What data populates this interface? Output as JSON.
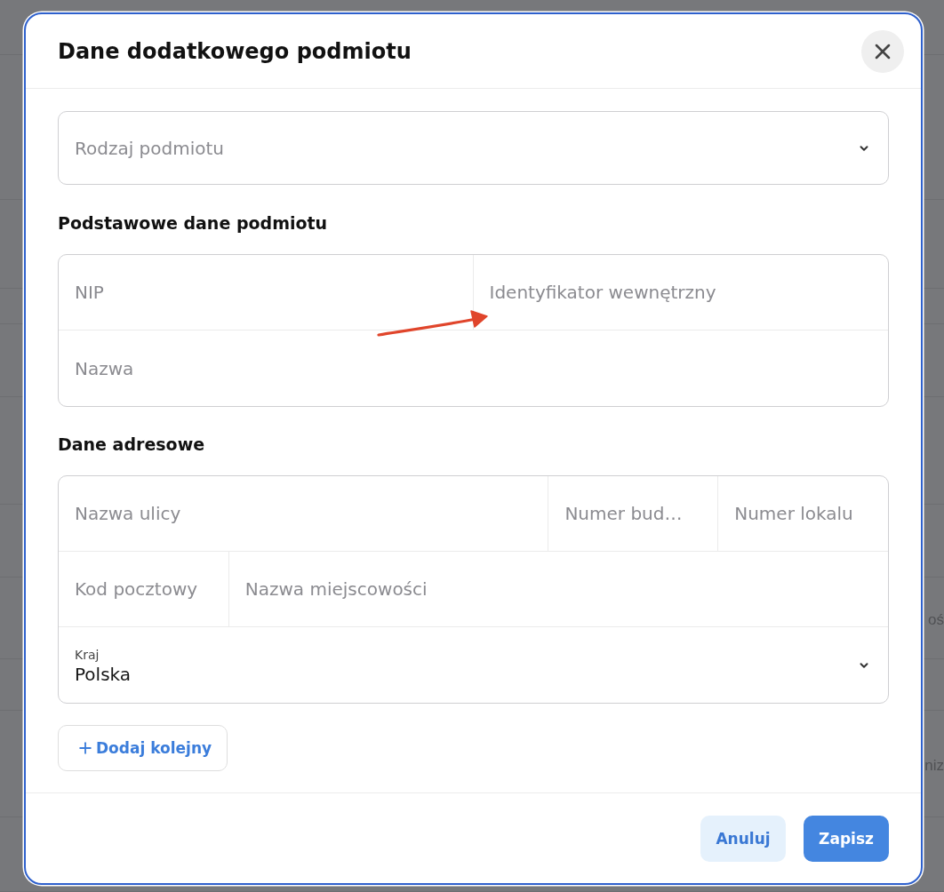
{
  "background": {
    "texts": [
      "oś",
      "niz"
    ]
  },
  "dialog": {
    "title": "Dane dodatkowego podmiotu"
  },
  "entity_type": {
    "placeholder": "Rodzaj podmiotu"
  },
  "sections": [
    {
      "title": "Podstawowe dane podmiotu",
      "rows": [
        [
          {
            "kind": "input",
            "placeholder": "NIP"
          },
          {
            "kind": "input",
            "placeholder": "Identyfikator wewnętrzny"
          }
        ],
        [
          {
            "kind": "input",
            "placeholder": "Nazwa"
          }
        ]
      ]
    },
    {
      "title": "Dane adresowe",
      "rows": [
        [
          {
            "kind": "input",
            "placeholder": "Nazwa ulicy"
          },
          {
            "kind": "input",
            "placeholder": "Numer bud…"
          },
          {
            "kind": "input",
            "placeholder": "Numer lokalu"
          }
        ],
        [
          {
            "kind": "input",
            "placeholder": "Kod pocztowy"
          },
          {
            "kind": "input",
            "placeholder": "Nazwa miejscowości"
          }
        ],
        [
          {
            "kind": "select",
            "label": "Kraj",
            "value": "Polska"
          }
        ]
      ]
    }
  ],
  "add_button": {
    "label": "Dodaj kolejny"
  },
  "footer_buttons": [
    {
      "kind": "secondary",
      "label": "Anuluj"
    },
    {
      "kind": "primary",
      "label": "Zapisz"
    }
  ]
}
